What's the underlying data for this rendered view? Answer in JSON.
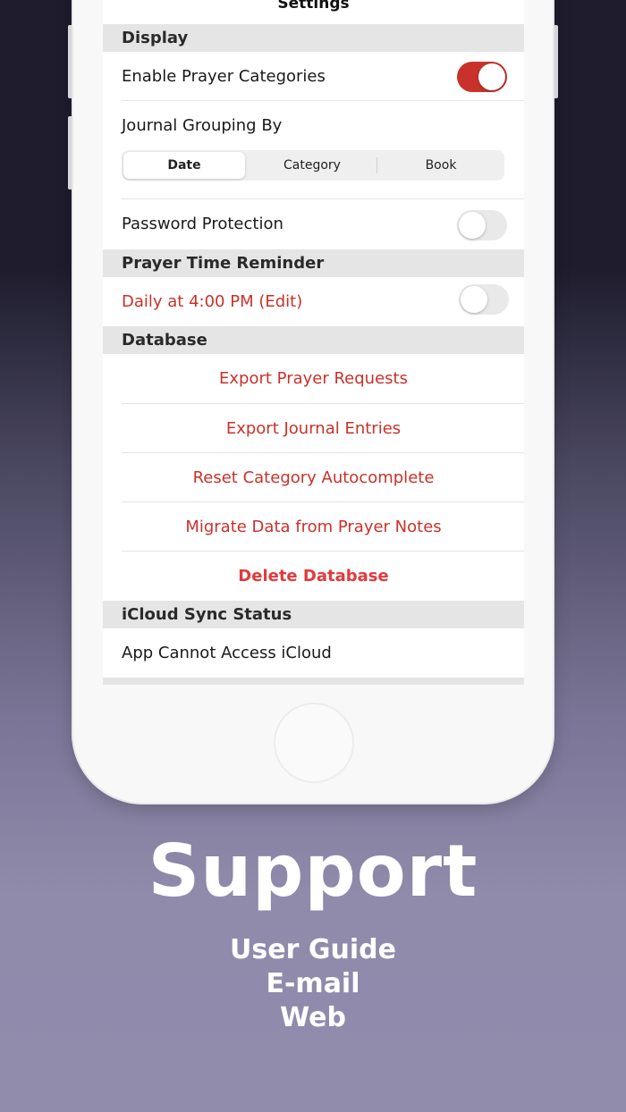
{
  "nav": {
    "title": "Settings"
  },
  "display": {
    "header": "Display",
    "enable_categories": {
      "label": "Enable Prayer Categories",
      "on": true
    },
    "journal_grouping": {
      "label": "Journal Grouping By",
      "options": [
        "Date",
        "Category",
        "Book"
      ],
      "selected": "Date"
    },
    "password": {
      "label": "Password Protection",
      "on": false
    }
  },
  "reminder": {
    "header": "Prayer Time Reminder",
    "label": "Daily at 4:00 PM (Edit)",
    "on": false
  },
  "database": {
    "header": "Database",
    "actions": [
      "Export Prayer Requests",
      "Export Journal Entries",
      "Reset Category Autocomplete",
      "Migrate Data from Prayer Notes",
      "Delete Database"
    ]
  },
  "icloud": {
    "header": "iCloud Sync Status",
    "status": "App Cannot Access iCloud"
  },
  "promo": {
    "title": "Support",
    "items": [
      "User Guide",
      "E-mail",
      "Web"
    ]
  },
  "colors": {
    "accent": "#c8322a",
    "destructive": "#e23a3a"
  }
}
